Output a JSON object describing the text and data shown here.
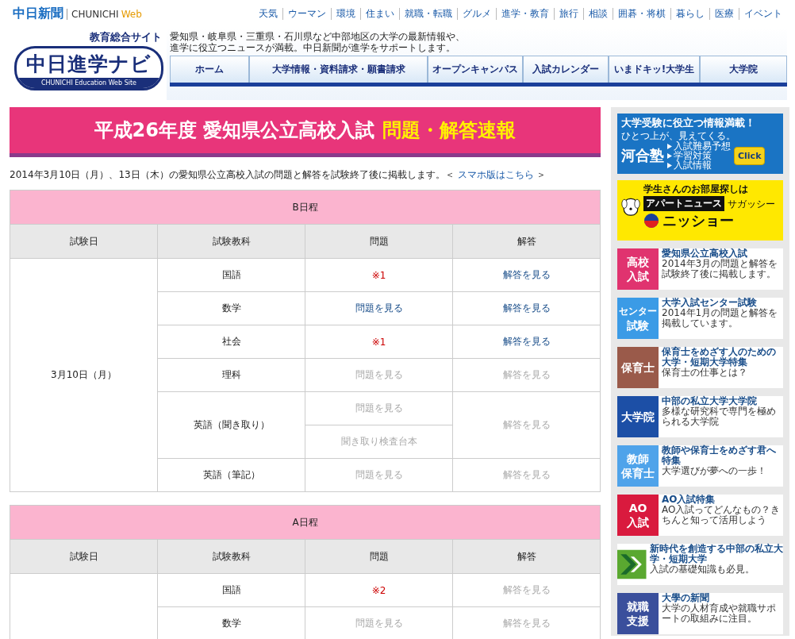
{
  "topbar": {
    "brand": "中日新聞",
    "brand_sub_1": "CHUNICHI",
    "brand_sub_2": "Web",
    "links": [
      "天気",
      "ウーマン",
      "環境",
      "住まい",
      "就職・転職",
      "グルメ",
      "進学・教育",
      "旅行",
      "相談",
      "囲碁・将棋",
      "暮らし",
      "医療",
      "イベント"
    ]
  },
  "site_logo": {
    "tagline": "教育総合サイト",
    "name": "中日進学ナビ",
    "sub": "CHUNICHI Education Web Site"
  },
  "description": [
    "愛知県・岐阜県・三重県・石川県など中部地区の大学の最新情報や、",
    "進学に役立つニュースが満載。中日新聞が進学をサポートします。"
  ],
  "nav_tabs": [
    "ホーム",
    "大学情報・資料請求・願書請求",
    "オープンキャンパス",
    "入試カレンダー",
    "いまドキッ!大学生",
    "大学院"
  ],
  "banner": {
    "title": "平成26年度 愛知県公立高校入試",
    "title_highlight": "問題・解答速報"
  },
  "intro": {
    "text": "2014年3月10日（月）、13日（木）の愛知県公立高校入試の問題と解答を試験終了後に掲載します。＜ ",
    "link": "スマホ版はこちら",
    "text_after": " ＞"
  },
  "tables": [
    {
      "title": "B日程",
      "columns": [
        "試験日",
        "試験教科",
        "問題",
        "解答"
      ],
      "date": "3月10日（月）",
      "rows": [
        {
          "subject": "国語",
          "problems": [
            {
              "kind": "note",
              "text": "※1"
            }
          ],
          "answer": {
            "kind": "link",
            "text": "解答を見る",
            "disabled": false
          }
        },
        {
          "subject": "数学",
          "problems": [
            {
              "kind": "link",
              "text": "問題を見る",
              "disabled": false
            }
          ],
          "answer": {
            "kind": "link",
            "text": "解答を見る",
            "disabled": false
          }
        },
        {
          "subject": "社会",
          "problems": [
            {
              "kind": "note",
              "text": "※1"
            }
          ],
          "answer": {
            "kind": "link",
            "text": "解答を見る",
            "disabled": false
          }
        },
        {
          "subject": "理科",
          "problems": [
            {
              "kind": "link",
              "text": "問題を見る",
              "disabled": true
            }
          ],
          "answer": {
            "kind": "link",
            "text": "解答を見る",
            "disabled": true
          }
        },
        {
          "subject": "英語（聞き取り）",
          "problems": [
            {
              "kind": "link",
              "text": "問題を見る",
              "disabled": true
            },
            {
              "kind": "link",
              "text": "聞き取り検査台本",
              "disabled": true
            }
          ],
          "answer": {
            "kind": "link",
            "text": "解答を見る",
            "disabled": true
          }
        },
        {
          "subject": "英語（筆記）",
          "problems": [
            {
              "kind": "link",
              "text": "問題を見る",
              "disabled": true
            }
          ],
          "answer": {
            "kind": "link",
            "text": "解答を見る",
            "disabled": true
          }
        }
      ]
    },
    {
      "title": "A日程",
      "columns": [
        "試験日",
        "試験教科",
        "問題",
        "解答"
      ],
      "rows": [
        {
          "subject": "国語",
          "problems": [
            {
              "kind": "note",
              "text": "※2"
            }
          ],
          "answer": {
            "kind": "link",
            "text": "解答を見る",
            "disabled": true
          }
        },
        {
          "subject": "数学",
          "problems": [
            {
              "kind": "link",
              "text": "問題を見る",
              "disabled": true
            }
          ],
          "answer": {
            "kind": "link",
            "text": "解答を見る",
            "disabled": true
          }
        }
      ]
    }
  ],
  "sidebar": {
    "ads": [
      {
        "kind": "cram",
        "headline": "大学受験に役立つ情報満載！",
        "slogan": "ひとつ上が、見えてくる。",
        "brand": "河合塾",
        "items": [
          "入試難易予想",
          "学習対策",
          "入試情報"
        ],
        "button": "Click"
      },
      {
        "kind": "rental",
        "headline": "学生さんのお部屋探しは",
        "badge": "アパートニュース",
        "mascot": "サガッシー",
        "brand": "ニッショー"
      }
    ],
    "items": [
      {
        "kind": "text",
        "badge": [
          "高校",
          "入試"
        ],
        "color": "#e0336f",
        "title": "愛知県公立高校入試",
        "desc": "2014年3月の問題と解答を試験終了後に掲載します。"
      },
      {
        "kind": "text",
        "badge": [
          "センター",
          "試験"
        ],
        "color": "#3b9be6",
        "title": "大学入試センター試験",
        "desc": "2014年1月の問題と解答を掲載しています。"
      },
      {
        "kind": "text",
        "badge": [
          "保育士"
        ],
        "color": "#9a5a4a",
        "title": "保育士をめざす人のための大学・短期大学特集",
        "desc": "保育士の仕事とは？"
      },
      {
        "kind": "text",
        "badge": [
          "大学院"
        ],
        "color": "#1c4fa6",
        "title": "中部の私立大学大学院",
        "desc": "多様な研究科で専門を極められる大学院"
      },
      {
        "kind": "text",
        "badge": [
          "教師",
          "保育士"
        ],
        "color": "#4fa3ea",
        "title": "教師や保育士をめざす君へ特集",
        "desc": "大学選びが夢への一歩！"
      },
      {
        "kind": "text",
        "badge": [
          "AO",
          "入試"
        ],
        "color": "#d91a3e",
        "title": "AO入試特集",
        "desc": "AO入試ってどんなもの？きちんと知って活用しよう"
      },
      {
        "kind": "arrow",
        "color": "#5aa830",
        "title": "新時代を創造する中部の私立大学・短期大学",
        "desc": "入試の基礎知識も必見。"
      },
      {
        "kind": "text",
        "badge": [
          "就職",
          "支援"
        ],
        "color": "#3a4f9c",
        "title": "大學の新聞",
        "desc": "大学の人材育成や就職サポートの取組みに注目。"
      }
    ]
  }
}
